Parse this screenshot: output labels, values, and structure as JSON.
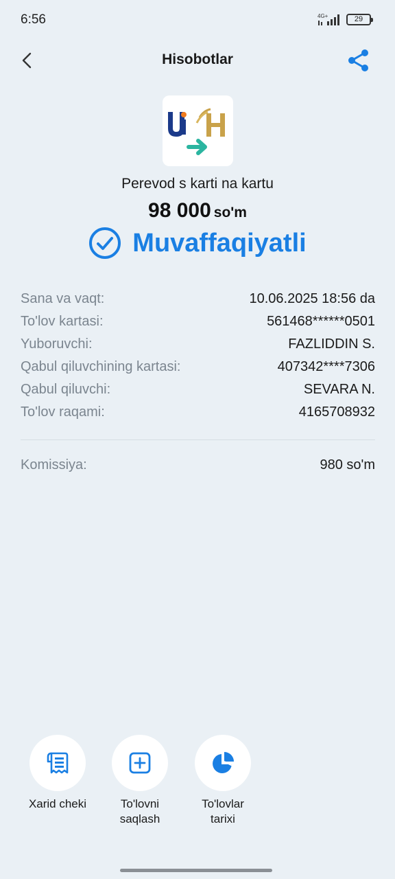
{
  "status_bar": {
    "time": "6:56",
    "network": "4G+",
    "battery": "29"
  },
  "header": {
    "title": "Hisobotlar"
  },
  "transfer": {
    "description": "Perevod s karti na kartu",
    "amount": "98 000",
    "currency": "so'm",
    "status": "Muvaffaqiyatli"
  },
  "details": [
    {
      "label": "Sana va vaqt:",
      "value": "10.06.2025 18:56 da"
    },
    {
      "label": "To'lov kartasi:",
      "value": "561468******0501"
    },
    {
      "label": "Yuboruvchi:",
      "value": "FAZLIDDIN S."
    },
    {
      "label": "Qabul qiluvchining kartasi:",
      "value": "407342****7306"
    },
    {
      "label": "Qabul qiluvchi:",
      "value": "SEVARA N."
    },
    {
      "label": "To'lov raqami:",
      "value": "4165708932"
    }
  ],
  "fee": {
    "label": "Komissiya:",
    "value": "980 so'm"
  },
  "actions": {
    "receipt": {
      "line1": "Xarid cheki",
      "line2": ""
    },
    "save": {
      "line1": "To'lovni",
      "line2": "saqlash"
    },
    "history": {
      "line1": "To'lovlar",
      "line2": "tarixi"
    }
  },
  "colors": {
    "accent": "#1a7fe3",
    "background": "#eaf0f5",
    "teal": "#2bb5a0",
    "gold": "#c9a24a",
    "navy": "#1b3a8a"
  }
}
